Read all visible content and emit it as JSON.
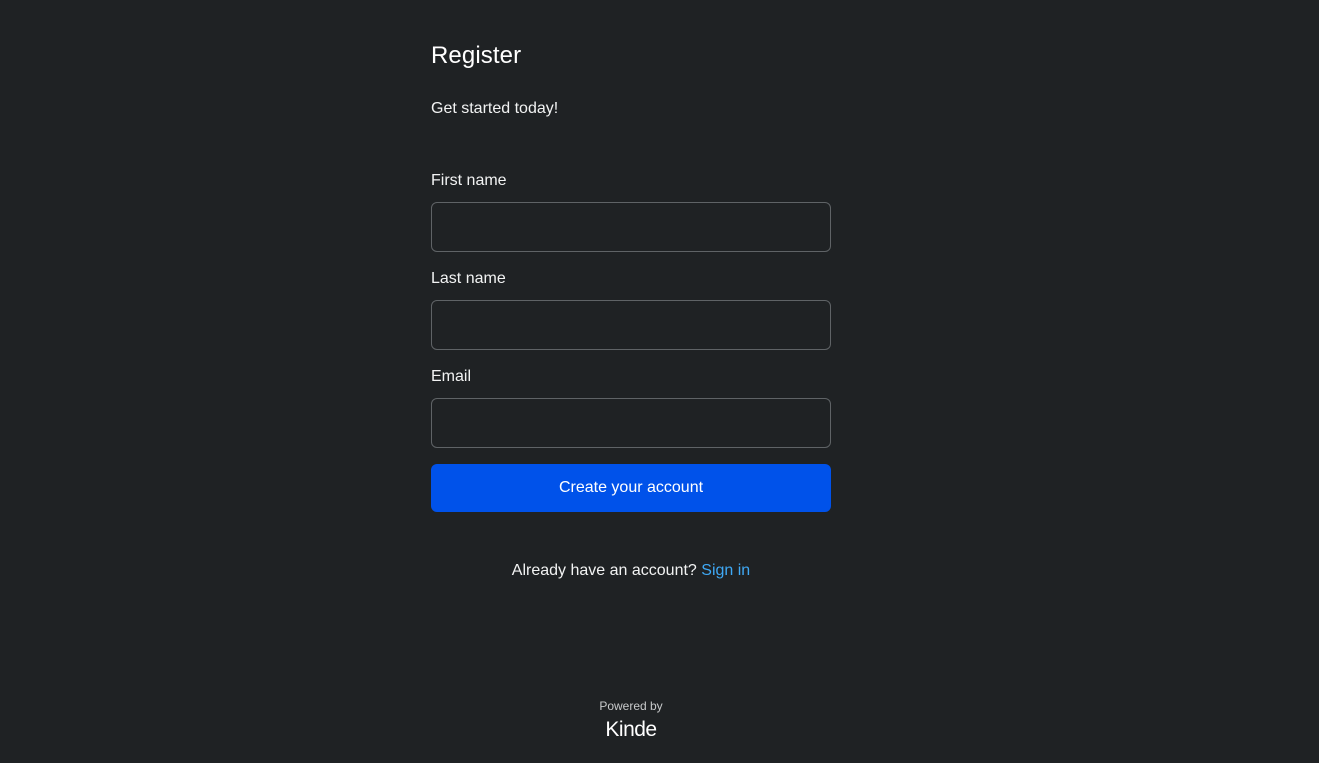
{
  "header": {
    "title": "Register",
    "subtitle": "Get started today!"
  },
  "form": {
    "first_name": {
      "label": "First name",
      "value": "",
      "placeholder": ""
    },
    "last_name": {
      "label": "Last name",
      "value": "",
      "placeholder": ""
    },
    "email": {
      "label": "Email",
      "value": "",
      "placeholder": ""
    },
    "submit_label": "Create your account"
  },
  "signin": {
    "prompt": "Already have an account?",
    "link_label": "Sign in"
  },
  "footer": {
    "powered_by": "Powered by",
    "brand": "Kinde"
  },
  "colors": {
    "background": "#1f2224",
    "primary_button": "#0052ea",
    "link": "#3fa9f5",
    "input_border": "#5f6366"
  }
}
